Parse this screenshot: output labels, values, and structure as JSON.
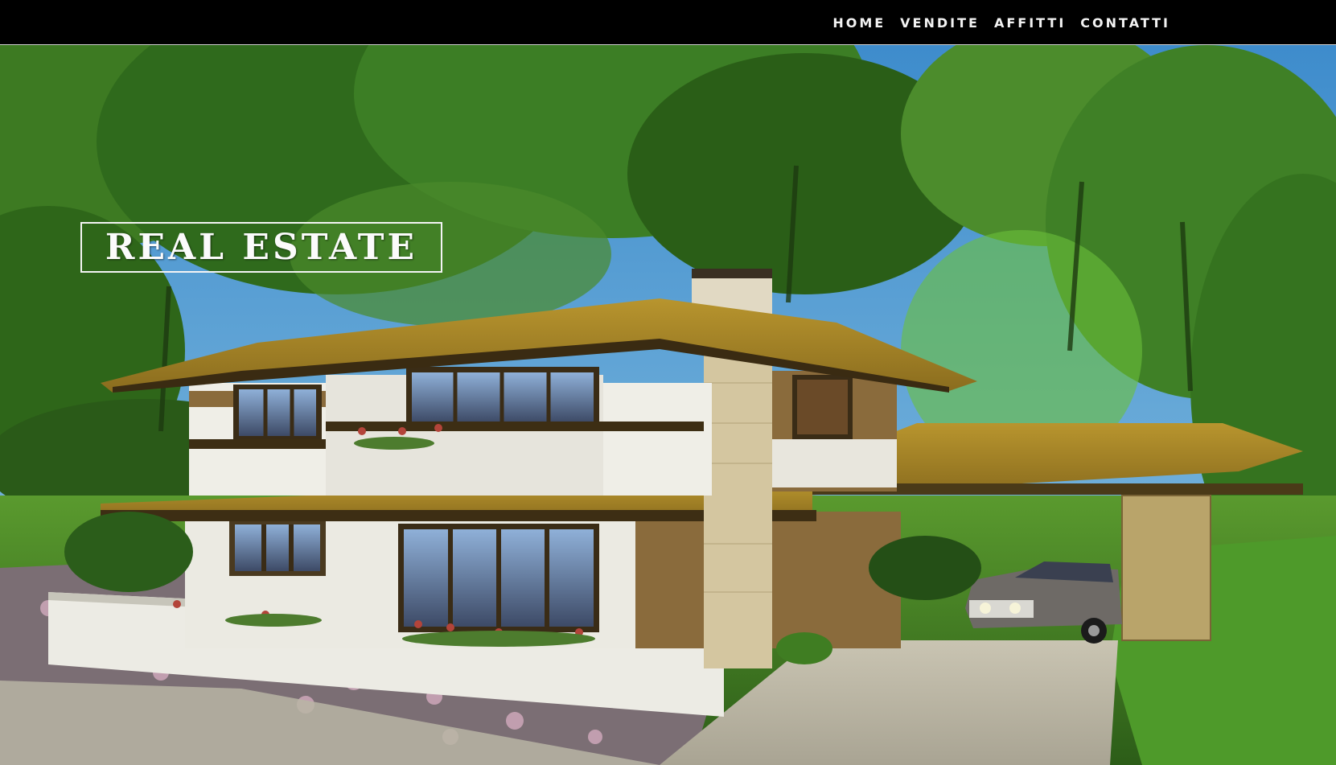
{
  "nav": {
    "items": [
      {
        "label": "HOME"
      },
      {
        "label": "VENDITE"
      },
      {
        "label": "AFFITTI"
      },
      {
        "label": "CONTATTI"
      }
    ]
  },
  "hero": {
    "logo_text": "REAL ESTATE",
    "image_alt": "illustrated prairie-style house with carport and car"
  },
  "colors": {
    "topbar": "#000000",
    "nav_text": "#f2f2f2",
    "logo_border": "#f4f4f4",
    "foliage": "#3f7d2a",
    "sky": "#4d9bd6"
  }
}
